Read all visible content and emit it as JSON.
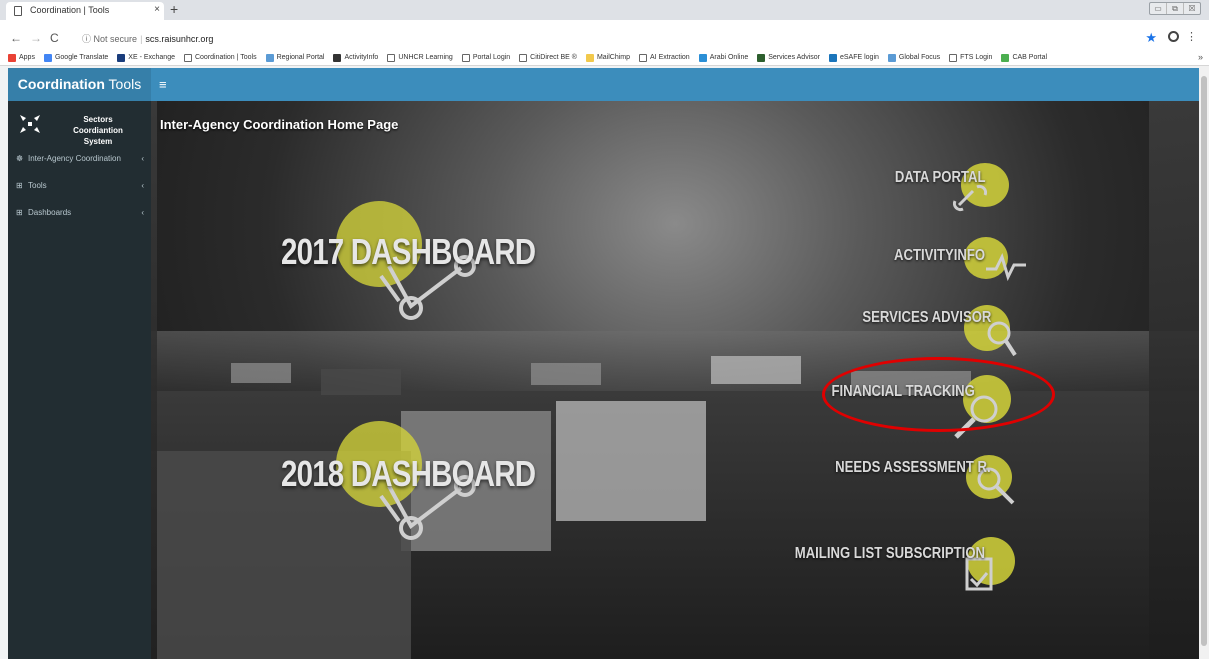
{
  "browser": {
    "tab_title": "Coordination | Tools",
    "tab_close": "×",
    "new_tab": "+",
    "security": "Not secure",
    "url": "scs.raisunhcr.org",
    "window_controls": [
      "▭",
      "⧉",
      "☒"
    ]
  },
  "bookmarks": [
    {
      "label": "Apps",
      "color": "#e94235"
    },
    {
      "label": "Google Translate",
      "color": "#4285f4"
    },
    {
      "label": "XE - Exchange",
      "color": "#1a3d7c"
    },
    {
      "label": "Coordination | Tools",
      "color": "#ffffff"
    },
    {
      "label": "Regional Portal",
      "color": "#5b9bd5"
    },
    {
      "label": "ActivityInfo",
      "color": "#333333"
    },
    {
      "label": "UNHCR Learning",
      "color": "#ffffff"
    },
    {
      "label": "Portal Login",
      "color": "#ffffff"
    },
    {
      "label": "CitiDirect BE ®",
      "color": "#ffffff"
    },
    {
      "label": "MailChimp",
      "color": "#f2c94c"
    },
    {
      "label": "AI Extraction",
      "color": "#ffffff"
    },
    {
      "label": "Arabi Online",
      "color": "#2b8fd6"
    },
    {
      "label": "Services Advisor",
      "color": "#2d5f2e"
    },
    {
      "label": "eSAFE login",
      "color": "#1b75bb"
    },
    {
      "label": "Global Focus",
      "color": "#5b9bd5"
    },
    {
      "label": "FTS Login",
      "color": "#ffffff"
    },
    {
      "label": "CAB Portal",
      "color": "#4caf50"
    }
  ],
  "header": {
    "brand_bold": "Coordination",
    "brand_light": " Tools",
    "menu_icon": "≡"
  },
  "sidebar": {
    "system_title": "Sectors Coordiantion System",
    "items": [
      {
        "label": "Inter-Agency Coordination",
        "icon": "dashboard-icon",
        "chev": "‹"
      },
      {
        "label": "Tools",
        "icon": "tools-icon",
        "chev": "‹"
      },
      {
        "label": "Dashboards",
        "icon": "dashboards-icon",
        "chev": "‹"
      }
    ]
  },
  "main": {
    "page_title": "Inter-Agency Coordination Home Page",
    "dashboards": [
      "2017 DASHBOARD",
      "2018 DASHBOARD"
    ],
    "links": [
      {
        "label": "DATA PORTAL",
        "icon": "link-icon"
      },
      {
        "label": "ACTIVITYINFO",
        "icon": "activity-icon"
      },
      {
        "label": "SERVICES ADVISOR",
        "icon": "magnifier-icon"
      },
      {
        "label": "FINANCIAL TRACKING",
        "icon": "money-search-icon"
      },
      {
        "label": "NEEDS ASSESSMENT R.",
        "icon": "search-icon"
      },
      {
        "label": "MAILING LIST SUBSCRIPTION",
        "icon": "mail-check-icon"
      }
    ],
    "accent_color": "#d4d43a",
    "highlight_color": "#e00000"
  }
}
